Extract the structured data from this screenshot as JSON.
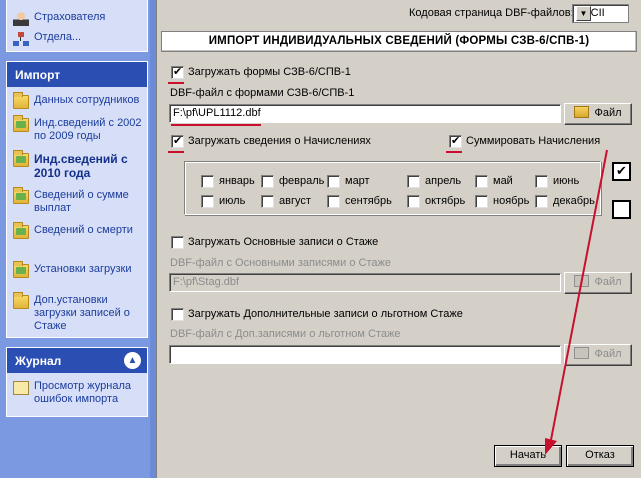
{
  "sidebar": {
    "top_items": [
      {
        "label": "Страхователя",
        "icon": "user-icon"
      },
      {
        "label": "Отдела...",
        "icon": "network-icon"
      }
    ],
    "import_panel": {
      "title": "Импорт",
      "items": [
        {
          "label": "Данных сотрудников",
          "icon": "folder-icon"
        },
        {
          "label": "Инд.сведений с 2002 по 2009 годы",
          "icon": "folder-icon"
        },
        {
          "label": "Инд.сведений с 2010 года",
          "icon": "folder-icon",
          "selected": true
        },
        {
          "label": "Сведений о сумме выплат",
          "icon": "folder-icon"
        },
        {
          "label": "Сведений о смерти",
          "icon": "folder-icon"
        },
        {
          "label": "Установки загрузки",
          "icon": "folder-settings-icon"
        },
        {
          "label": "Доп.установки загрузки записей о Стаже",
          "icon": "folder-settings-icon"
        }
      ]
    },
    "journal_panel": {
      "title": "Журнал",
      "items": [
        {
          "label": "Просмотр журнала ошибок импорта",
          "icon": "log-icon"
        }
      ]
    }
  },
  "main": {
    "codepage_label": "Кодовая страница DBF-файлов:",
    "codepage_value": "ASCII",
    "title": "ИМПОРТ ИНДИВИДУАЛЬНЫХ СВЕДЕНИЙ (ФОРМЫ СЗВ-6/СПВ-1)",
    "load_forms": {
      "label": "Загружать формы СЗВ-6/СПВ-1",
      "checked": true
    },
    "dbf_forms_label": "DBF-файл с формами СЗВ-6/СПВ-1",
    "dbf_forms_path": "F:\\pf\\UPL1112.dbf",
    "file_button": "Файл",
    "load_accruals": {
      "label": "Загружать сведения о Начислениях",
      "checked": true
    },
    "sum_accruals": {
      "label": "Суммировать Начисления",
      "checked": true
    },
    "months": [
      "январь",
      "февраль",
      "март",
      "апрель",
      "май",
      "июнь",
      "июль",
      "август",
      "сентябрь",
      "октябрь",
      "ноябрь",
      "декабрь"
    ],
    "load_basic_stazh": {
      "label": "Загружать Основные записи о Стаже",
      "checked": false
    },
    "dbf_basic_label": "DBF-файл с Основными записями о Стаже",
    "dbf_basic_path": "F:\\pf\\Stag.dbf",
    "load_extra_stazh": {
      "label": "Загружать Дополнительные записи о льготном Стаже",
      "checked": false
    },
    "dbf_extra_label": "DBF-файл с Доп.записями о льготном Стаже",
    "dbf_extra_path": "",
    "start_button": "Начать",
    "cancel_button": "Отказ"
  },
  "colors": {
    "highlight": "#c8102e",
    "panel_header": "#2b4eb3"
  }
}
